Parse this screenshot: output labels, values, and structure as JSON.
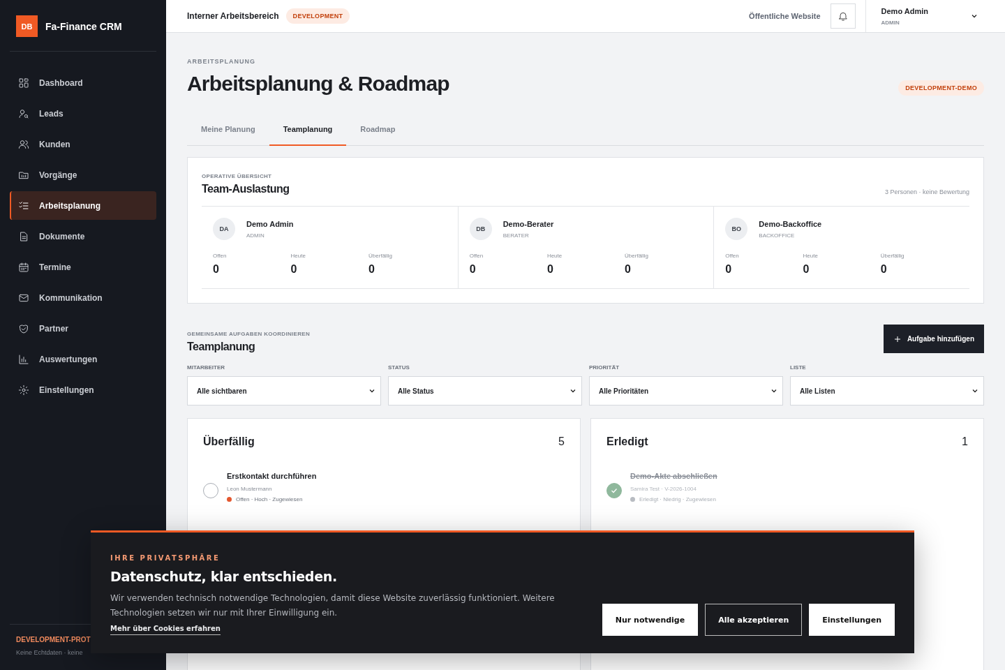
{
  "sidebar": {
    "brand": {
      "initials": "DB",
      "name": "Fa-Finance CRM"
    },
    "items": [
      {
        "label": "Dashboard",
        "selected": false
      },
      {
        "label": "Leads",
        "selected": false
      },
      {
        "label": "Kunden",
        "selected": false
      },
      {
        "label": "Vorgänge",
        "selected": false
      },
      {
        "label": "Arbeitsplanung",
        "selected": true
      },
      {
        "label": "Dokumente",
        "selected": false
      },
      {
        "label": "Termine",
        "selected": false
      },
      {
        "label": "Kommunikation",
        "selected": false
      },
      {
        "label": "Partner",
        "selected": false
      },
      {
        "label": "Auswertungen",
        "selected": false
      },
      {
        "label": "Einstellungen",
        "selected": false
      }
    ],
    "footer": {
      "title": "DEVELOPMENT-PROT",
      "subtitle": "Keine Echtdaten · keine"
    }
  },
  "topbar": {
    "workspace": "Interner Arbeitsbereich",
    "badge": "DEVELOPMENT",
    "public_link": "Öffentliche Website",
    "user": {
      "name": "Demo Admin",
      "role": "ADMIN"
    }
  },
  "page": {
    "eyebrow": "ARBEITSPLANUNG",
    "title": "Arbeitsplanung & Roadmap",
    "badge": "DEVELOPMENT-DEMO",
    "tabs": [
      {
        "label": "Meine Planung",
        "selected": false
      },
      {
        "label": "Teamplanung",
        "selected": true
      },
      {
        "label": "Roadmap",
        "selected": false
      }
    ]
  },
  "overview": {
    "eyebrow": "OPERATIVE ÜBERSICHT",
    "title": "Team-Auslastung",
    "summary": "3 Personen · keine Bewertung",
    "members": [
      {
        "initials": "DA",
        "name": "Demo Admin",
        "role": "ADMIN",
        "stats": [
          {
            "label": "Offen",
            "value": "0"
          },
          {
            "label": "Heute",
            "value": "0"
          },
          {
            "label": "Überfällig",
            "value": "0"
          }
        ]
      },
      {
        "initials": "DB",
        "name": "Demo-Berater",
        "role": "BERATER",
        "stats": [
          {
            "label": "Offen",
            "value": "0"
          },
          {
            "label": "Heute",
            "value": "0"
          },
          {
            "label": "Überfällig",
            "value": "0"
          }
        ]
      },
      {
        "initials": "BO",
        "name": "Demo-Backoffice",
        "role": "BACKOFFICE",
        "stats": [
          {
            "label": "Offen",
            "value": "0"
          },
          {
            "label": "Heute",
            "value": "0"
          },
          {
            "label": "Überfällig",
            "value": "0"
          }
        ]
      }
    ]
  },
  "team": {
    "eyebrow": "GEMEINSAME AUFGABEN KOORDINIEREN",
    "title": "Teamplanung",
    "add_button": "Aufgabe hinzufügen",
    "filters": [
      {
        "label": "MITARBEITER",
        "value": "Alle sichtbaren"
      },
      {
        "label": "STATUS",
        "value": "Alle Status"
      },
      {
        "label": "PRIORITÄT",
        "value": "Alle Prioritäten"
      },
      {
        "label": "LISTE",
        "value": "Alle Listen"
      }
    ]
  },
  "columns": [
    {
      "title": "Überfällig",
      "count": "5",
      "tasks": [
        {
          "title": "Erstkontakt durchführen",
          "meta": "Leon Mustermann",
          "status": "Offen · Hoch · Zugewiesen",
          "color": "#e4572e",
          "done": false
        }
      ]
    },
    {
      "title": "Erledigt",
      "count": "1",
      "tasks": [
        {
          "title": "Demo-Akte abschließen",
          "meta": "Samira Test · V-2026-1004",
          "status": "Erledigt · Niedrig · Zugewiesen",
          "color": "#b8bcc2",
          "done": true
        }
      ]
    }
  ],
  "cookie": {
    "eyebrow": "IHRE PRIVATSPHÄRE",
    "title": "Datenschutz, klar entschieden.",
    "text": "Wir verwenden technisch notwendige Technologien, damit diese Website zuverlässig funktioniert. Weitere Technologien setzen wir nur mit Ihrer Einwilligung ein.",
    "link": "Mehr über Cookies erfahren",
    "buttons": [
      {
        "label": "Nur notwendige",
        "kind": "light"
      },
      {
        "label": "Alle akzeptieren",
        "kind": "outline"
      },
      {
        "label": "Einstellungen",
        "kind": "light"
      }
    ]
  }
}
